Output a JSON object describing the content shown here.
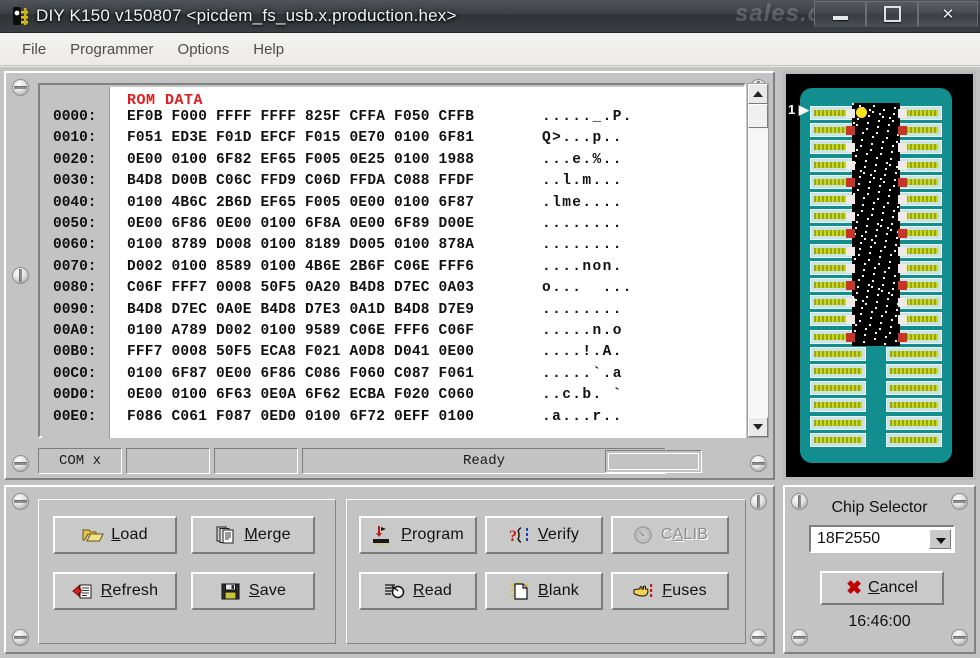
{
  "window": {
    "title": "DIY K150 v150807  <picdem_fs_usb.x.production.hex>",
    "icon": "ic-chip-icon",
    "watermark": "sales.com",
    "buttons": {
      "minimize": "minimize-icon",
      "maximize": "maximize-icon",
      "close": "✕"
    }
  },
  "menu": {
    "items": [
      {
        "label": "File"
      },
      {
        "label": "Programmer"
      },
      {
        "label": "Options"
      },
      {
        "label": "Help"
      }
    ]
  },
  "hex_view": {
    "header": "ROM DATA",
    "rows": [
      {
        "addr": "0000:",
        "bytes": "EF0B F000 FFFF FFFF 825F CFFA F050 CFFB",
        "ascii": "....._.P."
      },
      {
        "addr": "0010:",
        "bytes": "F051 ED3E F01D EFCF F015 0E70 0100 6F81",
        "ascii": "Q>...p.."
      },
      {
        "addr": "0020:",
        "bytes": "0E00 0100 6F82 EF65 F005 0E25 0100 1988",
        "ascii": "...e.%.."
      },
      {
        "addr": "0030:",
        "bytes": "B4D8 D00B C06C FFD9 C06D FFDA C088 FFDF",
        "ascii": "..l.m..."
      },
      {
        "addr": "0040:",
        "bytes": "0100 4B6C 2B6D EF65 F005 0E00 0100 6F87",
        "ascii": ".lme...."
      },
      {
        "addr": "0050:",
        "bytes": "0E00 6F86 0E00 0100 6F8A 0E00 6F89 D00E",
        "ascii": "........"
      },
      {
        "addr": "0060:",
        "bytes": "0100 8789 D008 0100 8189 D005 0100 878A",
        "ascii": "........"
      },
      {
        "addr": "0070:",
        "bytes": "D002 0100 8589 0100 4B6E 2B6F C06E FFF6",
        "ascii": "....non."
      },
      {
        "addr": "0080:",
        "bytes": "C06F FFF7 0008 50F5 0A20 B4D8 D7EC 0A03",
        "ascii": "o...  ..."
      },
      {
        "addr": "0090:",
        "bytes": "B4D8 D7EC 0A0E B4D8 D7E3 0A1D B4D8 D7E9",
        "ascii": "........"
      },
      {
        "addr": "00A0:",
        "bytes": "0100 A789 D002 0100 9589 C06E FFF6 C06F",
        "ascii": ".....n.o"
      },
      {
        "addr": "00B0:",
        "bytes": "FFF7 0008 50F5 ECA8 F021 A0D8 D041 0E00",
        "ascii": "....!.A."
      },
      {
        "addr": "00C0:",
        "bytes": "0100 6F87 0E00 6F86 C086 F060 C087 F061",
        "ascii": ".....`.a"
      },
      {
        "addr": "00D0:",
        "bytes": "0E00 0100 6F63 0E0A 6F62 ECBA F020 C060",
        "ascii": "..c.b. `"
      },
      {
        "addr": "00E0:",
        "bytes": "F086 C061 F087 0ED0 0100 6F72 0EFF 0100",
        "ascii": ".a...r.."
      }
    ]
  },
  "status_bar": {
    "com": "COM x",
    "field2": "",
    "field3": "",
    "message": "Ready",
    "progress": ""
  },
  "socket": {
    "pin1_marker": "1",
    "pin1_arrow": "▶",
    "rows_per_side": 20,
    "chip_pins": 28,
    "colors": {
      "board": "#128e8e",
      "chip": "#000000",
      "pin1_dot": "#ffe21f",
      "contact": "#c7d42c",
      "bezel": "#b9b9b9"
    }
  },
  "buttons": {
    "group_file": [
      {
        "name": "load",
        "pre": "",
        "mnemonic": "L",
        "post": "oad",
        "icon": "open-folder-icon",
        "enabled": true
      },
      {
        "name": "merge",
        "pre": "",
        "mnemonic": "M",
        "post": "erge",
        "icon": "copy-pages-icon",
        "enabled": true
      },
      {
        "name": "refresh",
        "pre": "",
        "mnemonic": "R",
        "post": "efresh",
        "icon": "refresh-doc-icon",
        "enabled": true
      },
      {
        "name": "save",
        "pre": "",
        "mnemonic": "S",
        "post": "ave",
        "icon": "floppy-disk-icon",
        "enabled": true
      }
    ],
    "group_device": [
      {
        "name": "program",
        "pre": "",
        "mnemonic": "P",
        "post": "rogram",
        "icon": "program-chip-icon",
        "enabled": true
      },
      {
        "name": "verify",
        "pre": "",
        "mnemonic": "V",
        "post": "erify",
        "icon": "question-chip-icon",
        "enabled": true
      },
      {
        "name": "calib",
        "pre": "C",
        "mnemonic": "A",
        "post": "LIB",
        "icon": "gauge-icon",
        "enabled": false
      },
      {
        "name": "read",
        "pre": "",
        "mnemonic": "R",
        "post": "ead",
        "icon": "read-doc-icon",
        "enabled": true
      },
      {
        "name": "blank",
        "pre": "",
        "mnemonic": "B",
        "post": "lank",
        "icon": "blank-page-icon",
        "enabled": true
      },
      {
        "name": "fuses",
        "pre": "",
        "mnemonic": "F",
        "post": "uses",
        "icon": "hand-point-icon",
        "enabled": true
      }
    ]
  },
  "chip_selector": {
    "title": "Chip Selector",
    "selected": "18F2550",
    "dropdown_icon": "chevron-down-icon",
    "cancel": {
      "pre": "",
      "mnemonic": "C",
      "post": "ancel",
      "icon": "red-x-icon"
    },
    "clock": "16:46:00"
  }
}
